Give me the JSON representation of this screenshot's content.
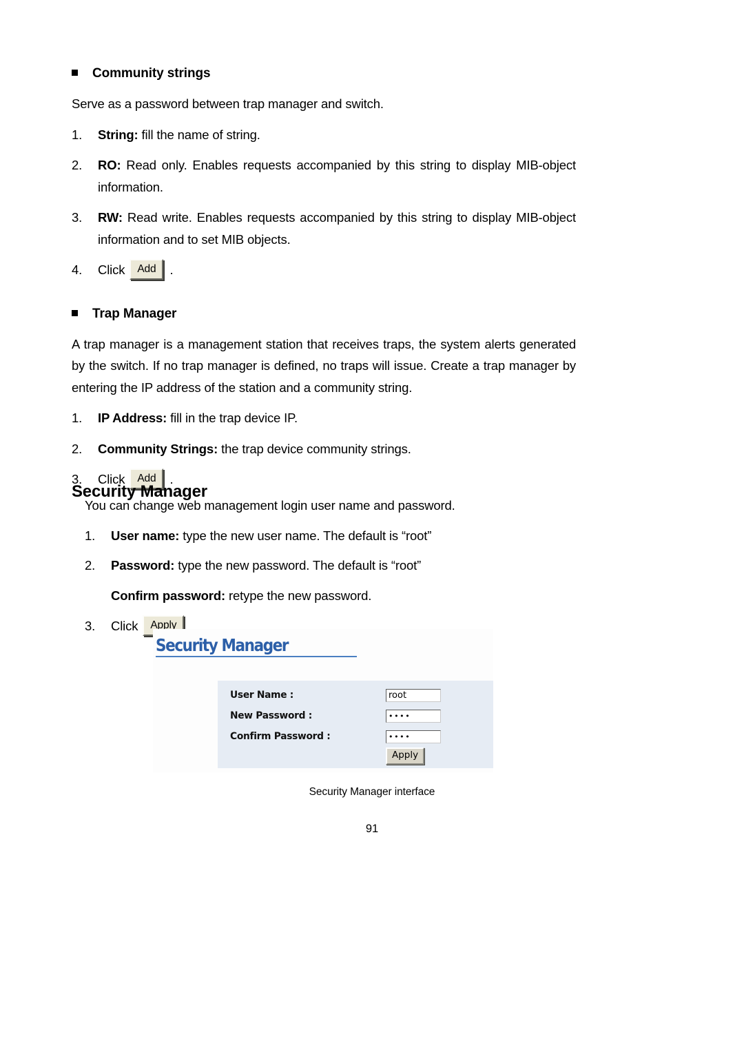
{
  "document": {
    "page_number": "91",
    "figure_caption": "Security Manager interface"
  },
  "community_strings": {
    "heading": "Community strings",
    "intro": "Serve as a password between trap manager and switch.",
    "items": [
      {
        "num": "1.",
        "label": "String:",
        "text": " fill the name of string."
      },
      {
        "num": "2.",
        "label": "RO:",
        "text": " Read only. Enables requests accompanied by this string to display MIB-object information."
      },
      {
        "num": "3.",
        "label": "RW:",
        "text": " Read write. Enables requests accompanied by this string to display MIB-object information and to set MIB objects."
      },
      {
        "num": "4.",
        "label": "",
        "text": "Click",
        "button": "Add",
        "tail": "."
      }
    ]
  },
  "trap_manager": {
    "heading": "Trap Manager",
    "paragraph": "A trap manager is a management station that receives traps, the system alerts generated by the switch. If no trap manager is defined, no traps will issue. Create a trap manager by entering the IP address of the station and a community string.",
    "items": [
      {
        "num": "1.",
        "label": "IP Address:",
        "text": " fill in the trap device IP."
      },
      {
        "num": "2.",
        "label": "Community Strings:",
        "text": " the trap device community strings."
      },
      {
        "num": "3.",
        "label": "",
        "text": "Click",
        "button": "Add",
        "tail": "."
      }
    ]
  },
  "security_manager": {
    "heading": "Security Manager",
    "intro": "You can change web management login user name and password.",
    "items": [
      {
        "num": "1.",
        "label": "User name:",
        "text": " type the new user name. The default is “root”"
      },
      {
        "num": "2.",
        "label": "Password:",
        "text": " type the new password. The default is “root”"
      }
    ],
    "subitem": {
      "label": "Confirm password:",
      "text": " retype the new password."
    },
    "click_item": {
      "num": "3.",
      "text": "Click",
      "button": "Apply",
      "tail": "."
    }
  },
  "screenshot": {
    "title": "Security Manager",
    "accent_color": "#2c5fa8",
    "panel_color": "#e6ecf4",
    "fields": [
      {
        "label": "User Name :",
        "value": "root",
        "masked": false
      },
      {
        "label": "New Password :",
        "value": "••••",
        "masked": true
      },
      {
        "label": "Confirm Password :",
        "value": "••••",
        "masked": true
      }
    ],
    "apply_label": "Apply"
  }
}
